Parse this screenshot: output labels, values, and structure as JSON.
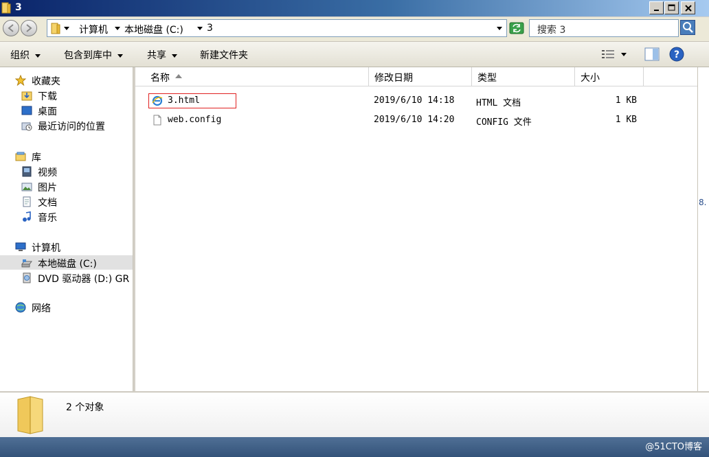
{
  "window": {
    "title": "3"
  },
  "address": {
    "crumbs": [
      "计算机",
      "本地磁盘 (C:)",
      "3"
    ]
  },
  "search": {
    "placeholder": "搜索 3"
  },
  "toolbar": {
    "organize": "组织",
    "include_library": "包含到库中",
    "share": "共享",
    "new_folder": "新建文件夹"
  },
  "nav": {
    "favorites": "收藏夹",
    "downloads": "下载",
    "desktop": "桌面",
    "recent": "最近访问的位置",
    "libraries": "库",
    "videos": "视频",
    "pictures": "图片",
    "documents": "文档",
    "music": "音乐",
    "computer": "计算机",
    "local_disk": "本地磁盘 (C:)",
    "dvd_drive": "DVD 驱动器 (D:) GR",
    "network": "网络"
  },
  "columns": {
    "name": "名称",
    "modified": "修改日期",
    "type": "类型",
    "size": "大小"
  },
  "files": [
    {
      "name": "3.html",
      "modified": "2019/6/10 14:18",
      "type": "HTML 文档",
      "size": "1 KB",
      "icon": "ie-html-icon"
    },
    {
      "name": "web.config",
      "modified": "2019/6/10 14:20",
      "type": "CONFIG 文件",
      "size": "1 KB",
      "icon": "blank-file-icon"
    }
  ],
  "details": {
    "count": "2 个对象"
  },
  "side_fragment": "8.",
  "watermark": "@51CTO博客",
  "colors": {
    "highlight_border": "#e02020",
    "selected_nav": "#e1e1e1"
  }
}
